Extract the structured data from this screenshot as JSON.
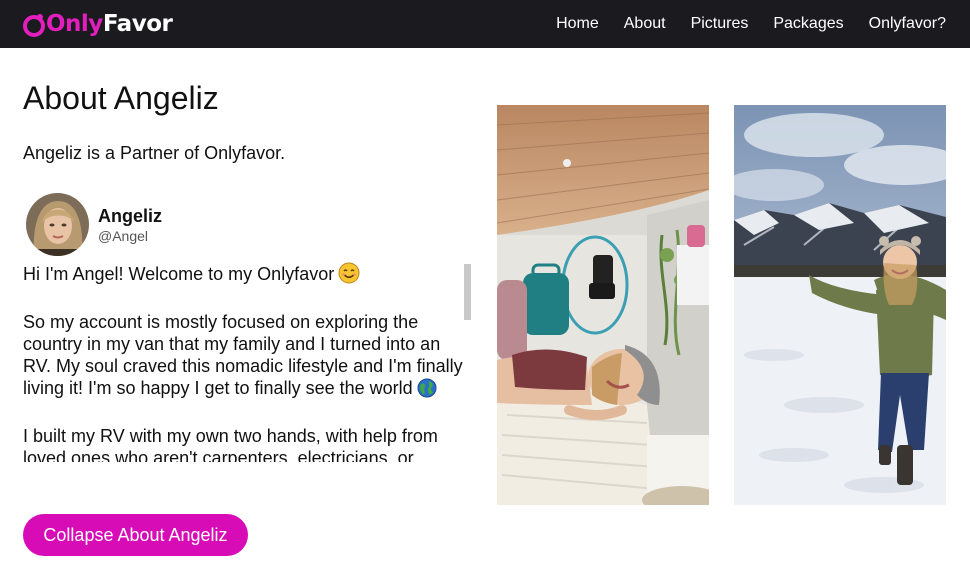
{
  "brand": {
    "logo_only": "Only",
    "logo_favor": "Favor",
    "accent": "#d80cb7"
  },
  "nav": {
    "items": [
      {
        "label": "Home"
      },
      {
        "label": "About"
      },
      {
        "label": "Pictures"
      },
      {
        "label": "Packages"
      },
      {
        "label": "Onlyfavor?"
      }
    ]
  },
  "about": {
    "title": "About Angeliz",
    "partner_text": "Angeliz is a Partner of Onlyfavor.",
    "profile": {
      "name": "Angeliz",
      "handle": "@Angel"
    },
    "bio": [
      "Hi I'm Angel! Welcome to my Onlyfavor",
      "So my account is mostly focused on exploring the country in my van that my family and I turned into an RV. My soul craved this nomadic lifestyle and I'm finally living it! I'm so happy I get to finally see the world",
      "I built my RV with my own two hands, with help from loved ones who aren't carpenters, electricians, or"
    ],
    "bio_emojis": [
      "smiling-face-emoji",
      "globe-emoji"
    ],
    "collapse_button": "Collapse About Angeliz"
  },
  "photos": [
    {
      "name": "van-interior-photo"
    },
    {
      "name": "snowy-mountain-photo"
    }
  ]
}
